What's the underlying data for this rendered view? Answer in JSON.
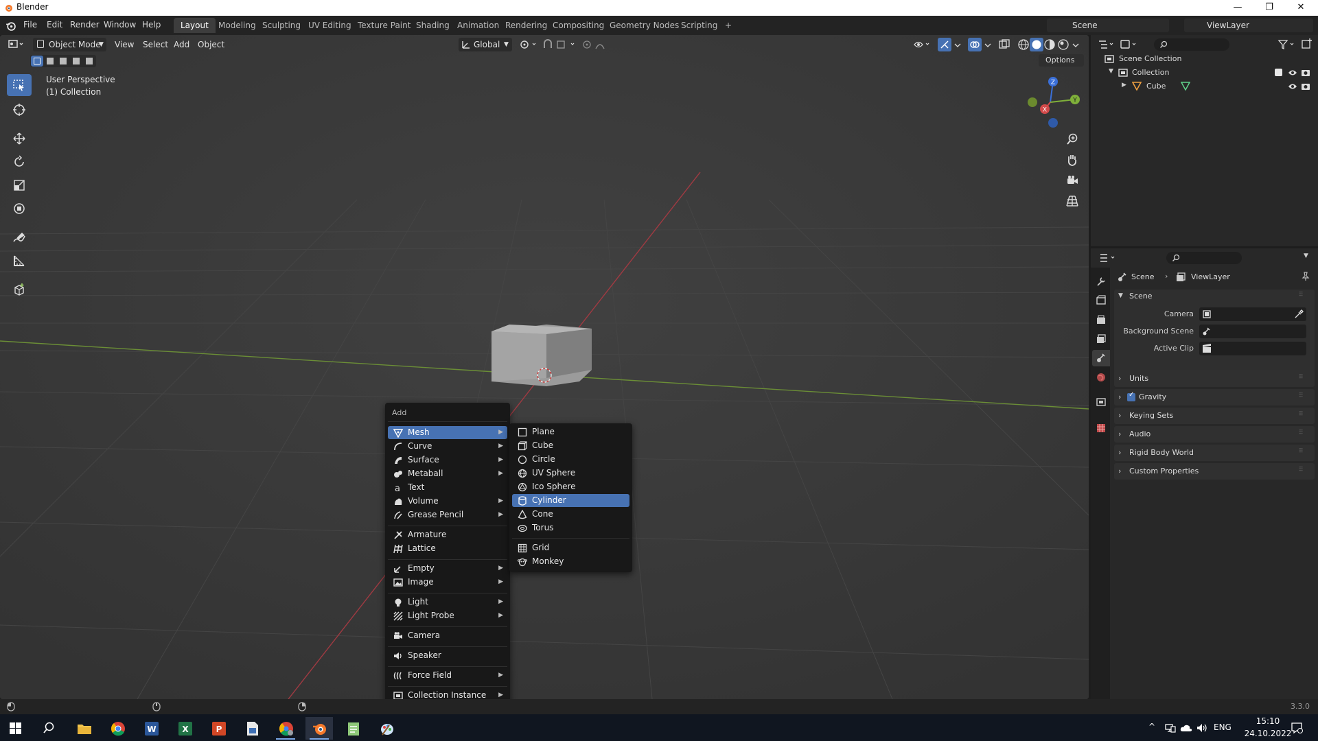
{
  "window": {
    "title": "Blender",
    "minimize": "—",
    "restore": "❐",
    "close": "✕"
  },
  "menubar": {
    "items": [
      "File",
      "Edit",
      "Render",
      "Window",
      "Help"
    ]
  },
  "workspaces": {
    "tabs": [
      "Layout",
      "Modeling",
      "Sculpting",
      "UV Editing",
      "Texture Paint",
      "Shading",
      "Animation",
      "Rendering",
      "Compositing",
      "Geometry Nodes",
      "Scripting"
    ],
    "active": "Layout",
    "add_label": "+"
  },
  "topright": {
    "scene_label": "Scene",
    "viewlayer_label": "ViewLayer"
  },
  "viewport": {
    "mode": "Object Mode",
    "menus": [
      "View",
      "Select",
      "Add",
      "Object"
    ],
    "transform_orientation": "Global",
    "options_label": "Options",
    "overlay_title": "User Perspective",
    "overlay_subtitle": "(1) Collection",
    "gizmo": {
      "x": "X",
      "y": "Y",
      "z": "Z"
    }
  },
  "add_menu": {
    "title": "Add",
    "items": [
      {
        "label": "Mesh",
        "icon": "mesh-icon",
        "submenu": true,
        "highlighted": true
      },
      {
        "label": "Curve",
        "icon": "curve-icon",
        "submenu": true
      },
      {
        "label": "Surface",
        "icon": "surface-icon",
        "submenu": true
      },
      {
        "label": "Metaball",
        "icon": "metaball-icon",
        "submenu": true
      },
      {
        "label": "Text",
        "icon": "text-icon",
        "submenu": false
      },
      {
        "label": "Volume",
        "icon": "volume-icon",
        "submenu": true
      },
      {
        "label": "Grease Pencil",
        "icon": "grease-pencil-icon",
        "submenu": true
      },
      {
        "label": "Armature",
        "icon": "armature-icon",
        "submenu": false
      },
      {
        "label": "Lattice",
        "icon": "lattice-icon",
        "submenu": false
      },
      {
        "label": "Empty",
        "icon": "empty-icon",
        "submenu": true
      },
      {
        "label": "Image",
        "icon": "image-icon",
        "submenu": true
      },
      {
        "label": "Light",
        "icon": "light-icon",
        "submenu": true
      },
      {
        "label": "Light Probe",
        "icon": "light-probe-icon",
        "submenu": true
      },
      {
        "label": "Camera",
        "icon": "camera-icon",
        "submenu": false
      },
      {
        "label": "Speaker",
        "icon": "speaker-icon",
        "submenu": false
      },
      {
        "label": "Force Field",
        "icon": "force-field-icon",
        "submenu": true
      },
      {
        "label": "Collection Instance",
        "icon": "collection-instance-icon",
        "submenu": true
      }
    ]
  },
  "mesh_menu": {
    "items": [
      {
        "label": "Plane",
        "icon": "plane-icon"
      },
      {
        "label": "Cube",
        "icon": "cube-icon"
      },
      {
        "label": "Circle",
        "icon": "circle-icon"
      },
      {
        "label": "UV Sphere",
        "icon": "uv-sphere-icon"
      },
      {
        "label": "Ico Sphere",
        "icon": "ico-sphere-icon"
      },
      {
        "label": "Cylinder",
        "icon": "cylinder-icon",
        "highlighted": true
      },
      {
        "label": "Cone",
        "icon": "cone-icon"
      },
      {
        "label": "Torus",
        "icon": "torus-icon"
      },
      {
        "label": "Grid",
        "icon": "grid-icon"
      },
      {
        "label": "Monkey",
        "icon": "monkey-icon"
      }
    ]
  },
  "outliner": {
    "root": "Scene Collection",
    "collection": "Collection",
    "object": "Cube"
  },
  "properties": {
    "breadcrumb_scene": "Scene",
    "breadcrumb_viewlayer": "ViewLayer",
    "scene_panel": "Scene",
    "camera_label": "Camera",
    "background_scene_label": "Background Scene",
    "active_clip_label": "Active Clip",
    "panels": [
      "Units",
      "Gravity",
      "Keying Sets",
      "Audio",
      "Rigid Body World",
      "Custom Properties"
    ]
  },
  "statusbar": {
    "version": "3.3.0"
  },
  "taskbar": {
    "language": "ENG",
    "time": "15:10",
    "date": "24.10.2022"
  },
  "colors": {
    "accent": "#4772b3",
    "viewport_bg": "#3a3a3a",
    "panel_bg": "#282828"
  }
}
